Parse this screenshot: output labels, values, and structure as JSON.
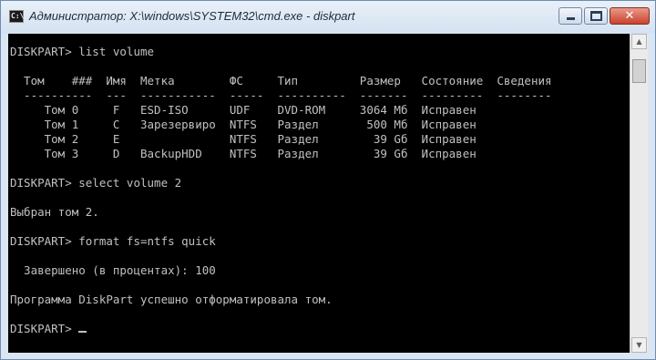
{
  "window": {
    "title": "Администратор: X:\\windows\\SYSTEM32\\cmd.exe - diskpart",
    "icon": "cmd-icon",
    "icon_label": "C:\\",
    "buttons": {
      "minimize": "minimize-icon",
      "maximize": "maximize-icon",
      "close": "close-icon",
      "close_glyph": "✕"
    }
  },
  "console": {
    "lines": [
      "DISKPART> list volume",
      "",
      "  Том    ###  Имя  Метка        ФС     Тип         Размер   Состояние  Сведения",
      "  ----------  ---  -----------  -----  ----------  -------  ---------  --------",
      "     Том 0     F   ESD-ISO      UDF    DVD-ROM     3064 Мб  Исправен",
      "     Том 1     C   Зарезервиро  NTFS   Раздел       500 Мб  Исправен",
      "     Том 2     E                NTFS   Раздел        39 Gб  Исправен",
      "     Том 3     D   BackupHDD    NTFS   Раздел        39 Gб  Исправен",
      "",
      "DISKPART> select volume 2",
      "",
      "Выбран том 2.",
      "",
      "DISKPART> format fs=ntfs quick",
      "",
      "  Завершено (в процентах): 100",
      "",
      "Программа DiskPart успешно отформатировала том.",
      "",
      "DISKPART> "
    ]
  },
  "scrollbar": {
    "up_glyph": "▲",
    "down_glyph": "▼"
  }
}
